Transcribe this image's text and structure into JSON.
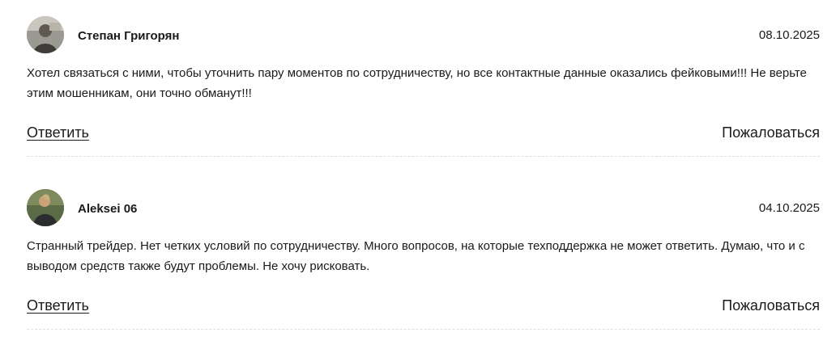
{
  "comments": [
    {
      "author": "Степан Григорян",
      "date": "08.10.2025",
      "text": "Хотел связаться с ними, чтобы уточнить пару моментов по сотрудничеству, но все контактные данные оказались фейковыми!!! Не верьте этим мошенникам, они точно обманут!!!",
      "reply_label": "Ответить",
      "complain_label": "Пожаловаться"
    },
    {
      "author": "Aleksei 06",
      "date": "04.10.2025",
      "text": "Странный трейдер. Нет четких условий по сотрудничеству. Много вопросов, на которые техподдержка не может ответить. Думаю, что и с выводом средств также будут проблемы. Не хочу рисковать.",
      "reply_label": "Ответить",
      "complain_label": "Пожаловаться"
    }
  ]
}
